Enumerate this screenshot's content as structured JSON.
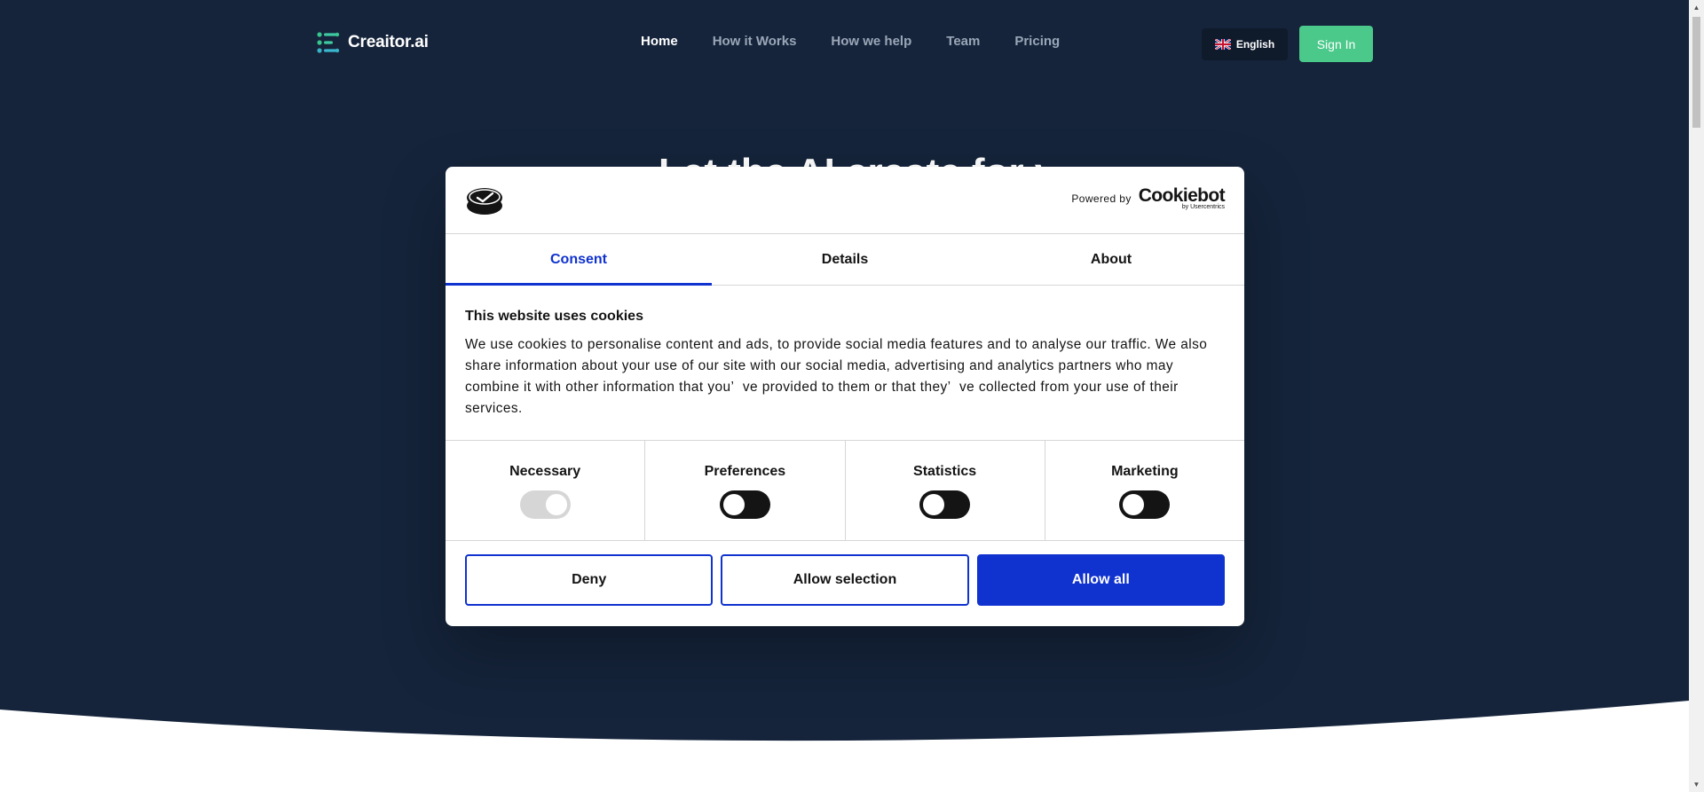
{
  "header": {
    "brand": "Creaitor.ai",
    "nav": [
      {
        "label": "Home",
        "active": true
      },
      {
        "label": "How it Works",
        "active": false
      },
      {
        "label": "How we help",
        "active": false
      },
      {
        "label": "Team",
        "active": false
      },
      {
        "label": "Pricing",
        "active": false
      }
    ],
    "language_label": "English",
    "signin_label": "Sign In"
  },
  "hero": {
    "heading": "Let the AI create for you"
  },
  "cookie_dialog": {
    "powered_by": "Powered by",
    "brand_name": "Cookiebot",
    "brand_sub": "by Usercentrics",
    "tabs": [
      {
        "label": "Consent",
        "active": true
      },
      {
        "label": "Details",
        "active": false
      },
      {
        "label": "About",
        "active": false
      }
    ],
    "title": "This website uses cookies",
    "text": "We use cookies to personalise content and ads, to provide social media features and to analyse our traffic. We also share information about your use of our site with our social media, advertising and analytics partners who may combine it with other information that you’  ve provided to them or that they’  ve collected from your use of their services.",
    "categories": [
      {
        "label": "Necessary",
        "enabled": true,
        "locked": true
      },
      {
        "label": "Preferences",
        "enabled": false,
        "locked": false
      },
      {
        "label": "Statistics",
        "enabled": false,
        "locked": false
      },
      {
        "label": "Marketing",
        "enabled": false,
        "locked": false
      }
    ],
    "buttons": {
      "deny": "Deny",
      "allow_selection": "Allow selection",
      "allow_all": "Allow all"
    }
  },
  "colors": {
    "hero_bg": "#15243b",
    "accent_green": "#4bc98a",
    "consent_blue": "#1032cf"
  }
}
